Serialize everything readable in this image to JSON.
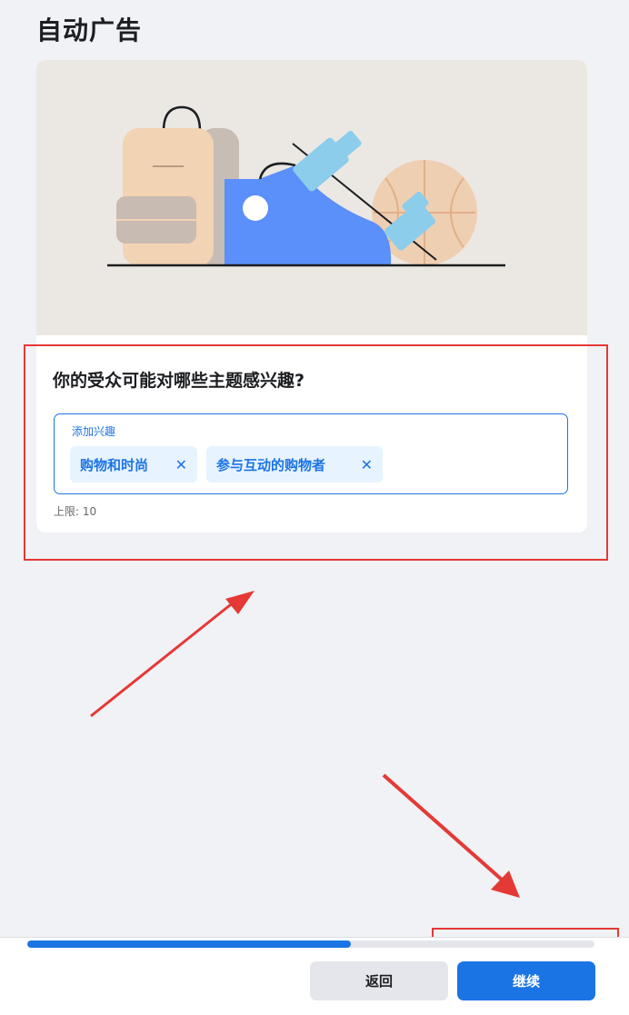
{
  "page": {
    "title": "自动广告"
  },
  "card": {
    "question": "你的受众可能对哪些主题感兴趣?",
    "interest_field": {
      "label": "添加兴趣",
      "chips": [
        {
          "label": "购物和时尚",
          "remove": "✕"
        },
        {
          "label": "参与互动的购物者",
          "remove": "✕"
        }
      ]
    },
    "limit_text": "上限: 10"
  },
  "footer": {
    "progress": 0.57,
    "back_label": "返回",
    "continue_label": "继续"
  },
  "colors": {
    "accent": "#1b74e4",
    "annotation": "#e53935",
    "chip_bg": "#e7f3ff"
  }
}
